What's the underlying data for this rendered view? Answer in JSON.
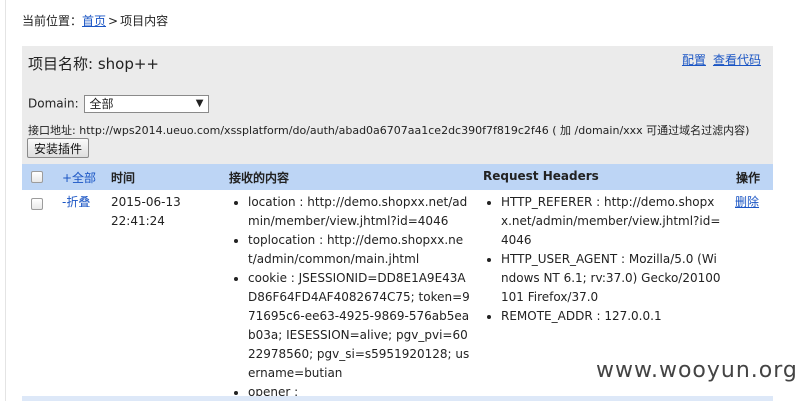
{
  "breadcrumb": {
    "label": "当前位置：",
    "home": "首页",
    "separator": ">",
    "current": "项目内容"
  },
  "project": {
    "title": "项目名称: shop++",
    "links": [
      "配置",
      "查看代码"
    ],
    "domain_label": "Domain:",
    "domain_value": "全部",
    "api_label": "接口地址:",
    "api_url": "http://wps2014.ueuo.com/xssplatform/do/auth/abad0a6707aa1ce2dc390f7f819c2f46",
    "api_hint": "( 加 /domain/xxx 可通过域名过滤内容)",
    "install_button": "安装插件"
  },
  "table": {
    "headers": {
      "expand_all": "+全部",
      "time": "时间",
      "content": "接收的内容",
      "request_headers": "Request Headers",
      "action": "操作"
    },
    "rows": [
      {
        "toggle": "-折叠",
        "date": "2015-06-13",
        "time": "22:41:24",
        "content": [
          "location : http://demo.shopxx.net/admin/member/view.jhtml?id=4046",
          "toplocation : http://demo.shopxx.net/admin/common/main.jhtml",
          "cookie : JSESSIONID=DD8E1A9E43AD86F64FD4AF4082674C75; token=971695c6-ee63-4925-9869-576ab5eab03a; IESESSION=alive; pgv_pvi=6022978560; pgv_si=s5951920128; username=butian",
          "opener :"
        ],
        "headers": [
          "HTTP_REFERER : http://demo.shopxx.net/admin/member/view.jhtml?id=4046",
          "HTTP_USER_AGENT : Mozilla/5.0 (Windows NT 6.1; rv:37.0) Gecko/20100101 Firefox/37.0",
          "REMOTE_ADDR : 127.0.0.1"
        ],
        "action": "删除"
      }
    ]
  },
  "watermark": "www.wooyun.org"
}
